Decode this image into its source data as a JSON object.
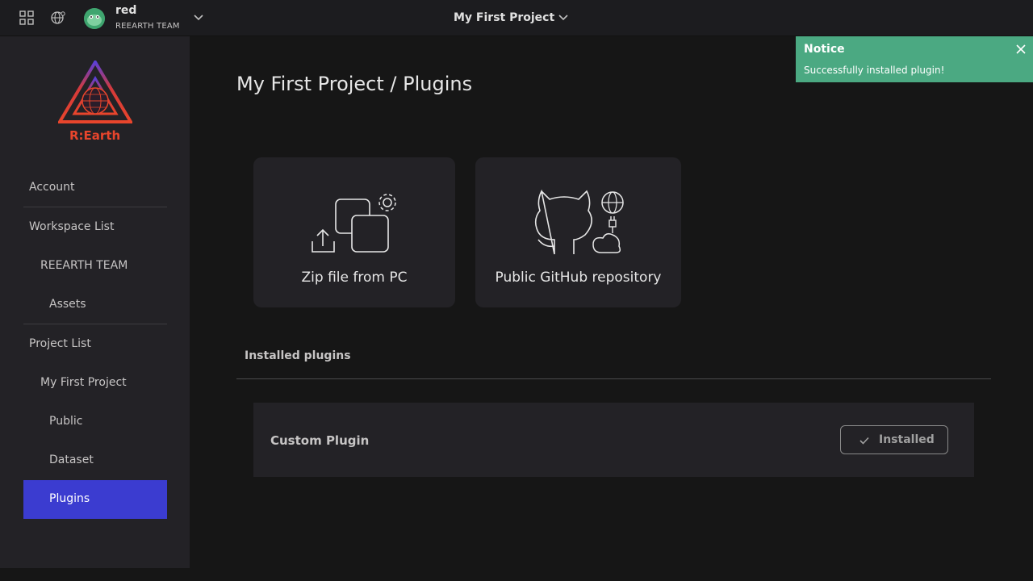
{
  "topbar": {
    "user_name": "red",
    "team_name": "REEARTH TEAM",
    "project_title": "My First Project"
  },
  "sidebar": {
    "logo_text": "R:Earth",
    "items": [
      {
        "label": "Account"
      },
      {
        "label": "Workspace List"
      },
      {
        "label": "REEARTH TEAM"
      },
      {
        "label": "Assets"
      },
      {
        "label": "Project List"
      },
      {
        "label": "My First Project"
      },
      {
        "label": "Public"
      },
      {
        "label": "Dataset"
      },
      {
        "label": "Plugins",
        "active": true
      }
    ]
  },
  "main": {
    "title": "My First Project / Plugins",
    "cards": [
      {
        "label": "Zip file from PC"
      },
      {
        "label": "Public GitHub repository"
      }
    ],
    "installed_section": {
      "title": "Installed plugins",
      "plugins": [
        {
          "name": "Custom Plugin",
          "status_label": "Installed"
        }
      ]
    }
  },
  "notice": {
    "title": "Notice",
    "message": "Successfully installed plugin!"
  },
  "colors": {
    "accent": "#3b3cd0",
    "notice_bg": "#4ba982",
    "logo_orange": "#e8452c",
    "background": "#161616",
    "panel": "#232226"
  }
}
